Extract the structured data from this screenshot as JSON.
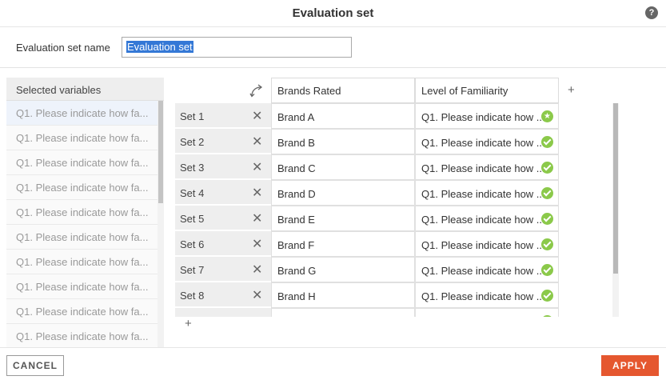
{
  "dialog": {
    "title": "Evaluation set",
    "help_icon": "help-icon",
    "help_glyph": "?"
  },
  "name_field": {
    "label": "Evaluation set name",
    "value": "Evaluation set"
  },
  "variables": {
    "header": "Selected variables",
    "items": [
      "Q1. Please indicate how fa...",
      "Q1. Please indicate how fa...",
      "Q1. Please indicate how fa...",
      "Q1. Please indicate how fa...",
      "Q1. Please indicate how fa...",
      "Q1. Please indicate how fa...",
      "Q1. Please indicate how fa...",
      "Q1. Please indicate how fa...",
      "Q1. Please indicate how fa...",
      "Q1. Please indicate how fa..."
    ]
  },
  "grid": {
    "columns": [
      "Brands Rated",
      "Level of Familiarity"
    ],
    "add_column_glyph": "+",
    "add_row_glyph": "+",
    "remove_glyph": "✕",
    "rows": [
      {
        "set": "Set 1",
        "brand": "Brand A",
        "familiarity": "Q1. Please indicate how ...",
        "status": "star"
      },
      {
        "set": "Set 2",
        "brand": "Brand B",
        "familiarity": "Q1. Please indicate how ...",
        "status": "check"
      },
      {
        "set": "Set 3",
        "brand": "Brand C",
        "familiarity": "Q1. Please indicate how ...",
        "status": "check"
      },
      {
        "set": "Set 4",
        "brand": "Brand D",
        "familiarity": "Q1. Please indicate how ...",
        "status": "check"
      },
      {
        "set": "Set 5",
        "brand": "Brand E",
        "familiarity": "Q1. Please indicate how ...",
        "status": "check"
      },
      {
        "set": "Set 6",
        "brand": "Brand F",
        "familiarity": "Q1. Please indicate how ...",
        "status": "check"
      },
      {
        "set": "Set 7",
        "brand": "Brand G",
        "familiarity": "Q1. Please indicate how ...",
        "status": "check"
      },
      {
        "set": "Set 8",
        "brand": "Brand H",
        "familiarity": "Q1. Please indicate how ...",
        "status": "check"
      }
    ]
  },
  "footer": {
    "cancel_label": "CANCEL",
    "apply_label": "APPLY"
  },
  "colors": {
    "accent": "#e5572f",
    "check": "#8bc94a",
    "selection": "#3478d6"
  }
}
